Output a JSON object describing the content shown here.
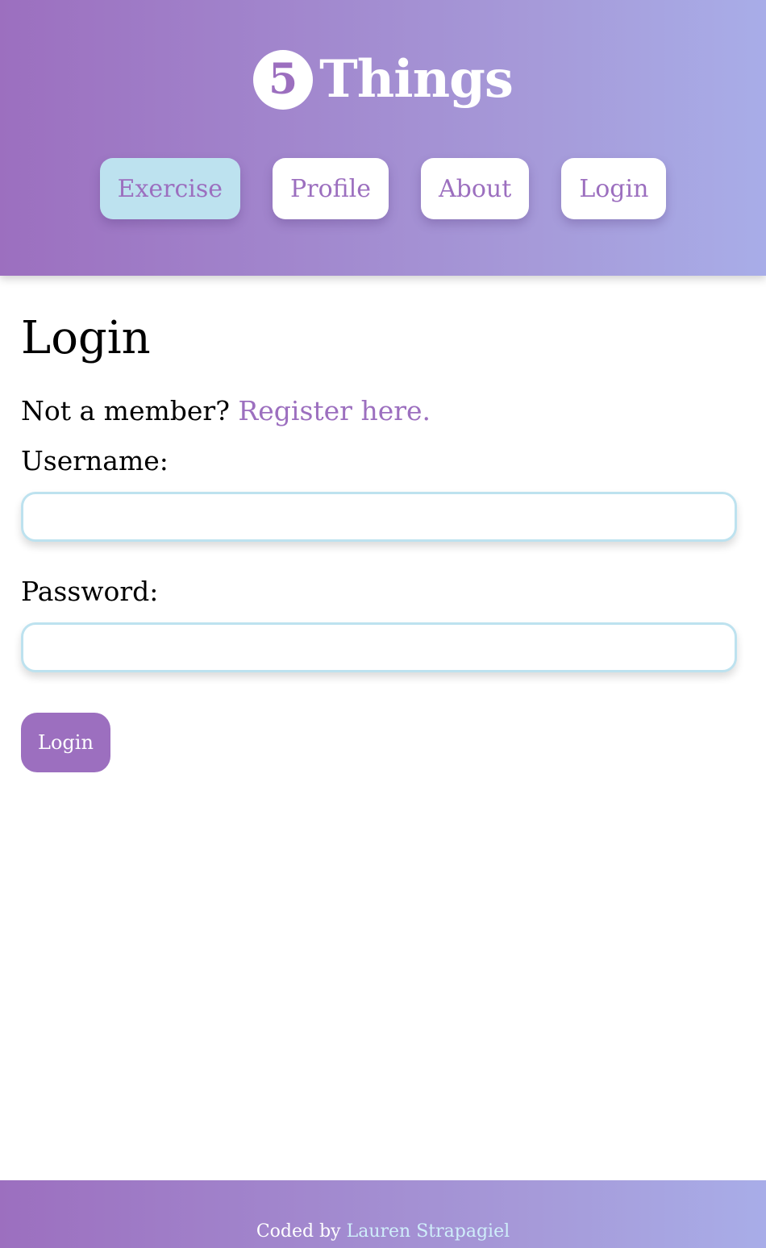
{
  "header": {
    "logo_number": "5",
    "logo_text": "Things"
  },
  "nav": {
    "items": [
      {
        "label": "Exercise",
        "active": true
      },
      {
        "label": "Profile",
        "active": false
      },
      {
        "label": "About",
        "active": false
      },
      {
        "label": "Login",
        "active": false
      }
    ]
  },
  "main": {
    "title": "Login",
    "register_prompt": "Not a member?",
    "register_link": "Register here.",
    "username_label": "Username:",
    "username_value": "",
    "password_label": "Password:",
    "password_value": "",
    "submit_label": "Login"
  },
  "footer": {
    "coded_by": "Coded by",
    "author": "Lauren Strapagiel"
  },
  "colors": {
    "brand_purple": "#9c6fbf",
    "gradient_end": "#a8ade8",
    "accent_light_blue": "#bde2ef",
    "footer_link": "#cfeefa"
  },
  "icons": {
    "logo": "number-5-circle-icon"
  }
}
